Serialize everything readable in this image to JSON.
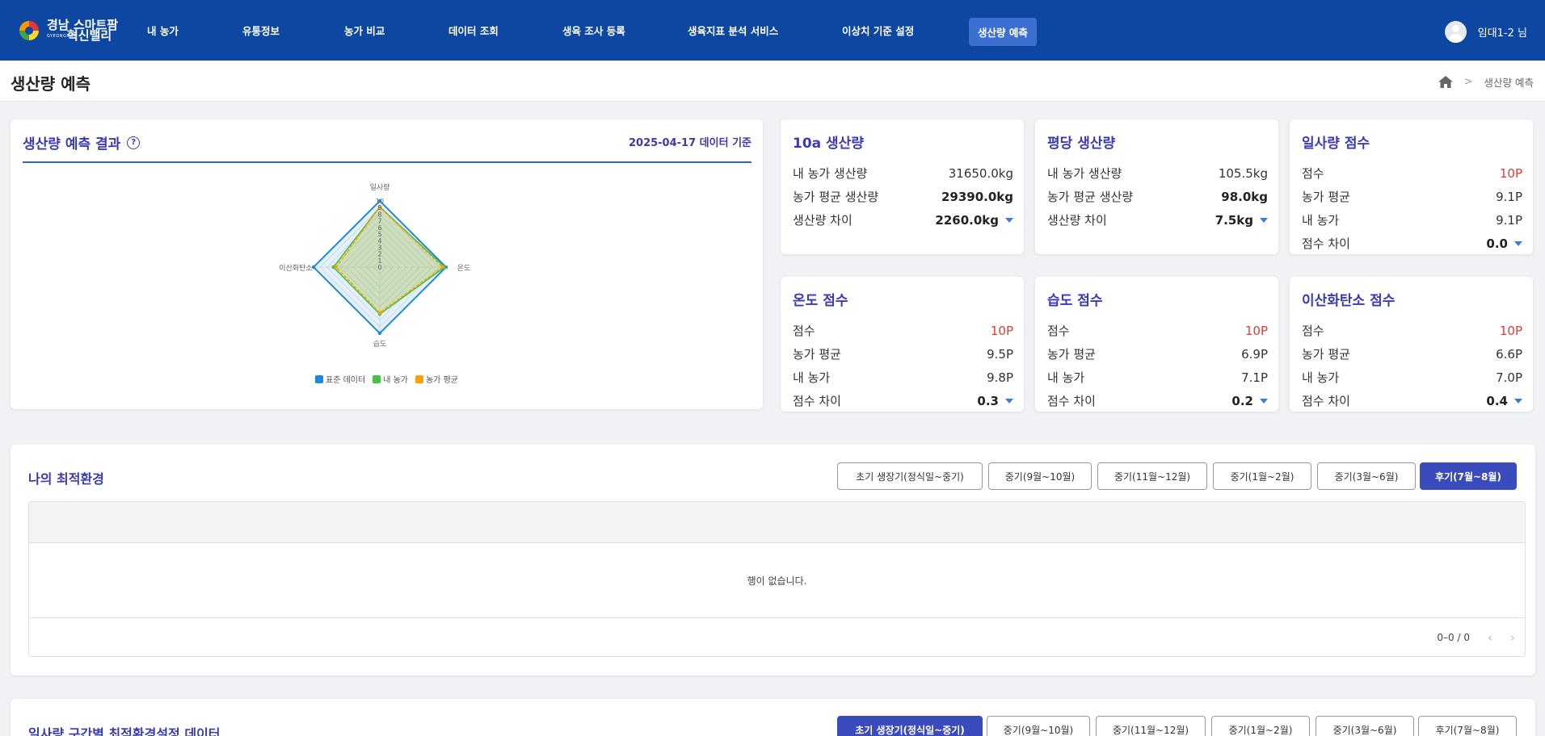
{
  "header": {
    "logo_main": "경남",
    "logo_line1": "스마트팜",
    "logo_line2": "혁신밸리",
    "logo_sub": "GYEONGNAM",
    "nav": [
      {
        "label": "내 농가"
      },
      {
        "label": "유통정보"
      },
      {
        "label": "농가 비교"
      },
      {
        "label": "데이터 조회"
      },
      {
        "label": "생육 조사 등록"
      },
      {
        "label": "생육지표 분석 서비스"
      },
      {
        "label": "이상치 기준 설정"
      },
      {
        "label": "생산량 예측",
        "active": true
      }
    ],
    "user_name": "임대1-2 님",
    "brand_color": "#0d47a1"
  },
  "page": {
    "title": "생산량 예측",
    "breadcrumb_current": "생산량 예측"
  },
  "result": {
    "title": "생산량 예측 결과",
    "help_icon": "?",
    "date": "2025-04-17 데이터 기준",
    "radar": {
      "axes": [
        "일사량",
        "온도",
        "습도",
        "이산화탄소"
      ],
      "ticks": [
        "10",
        "9",
        "8",
        "7",
        "6",
        "5",
        "4",
        "3",
        "2",
        "1",
        "0"
      ]
    },
    "legend": [
      {
        "label": "표준 데이터",
        "color": "#1e88e5"
      },
      {
        "label": "내 농가",
        "color": "#43c443"
      },
      {
        "label": "농가 평균",
        "color": "#ffa000"
      }
    ]
  },
  "chart_data": {
    "type": "radar",
    "axes": [
      "일사량",
      "온도",
      "습도",
      "이산화탄소"
    ],
    "range": [
      0,
      10
    ],
    "series": [
      {
        "name": "표준 데이터",
        "values": [
          10,
          10,
          10,
          10
        ]
      },
      {
        "name": "내 농가",
        "values": [
          9.1,
          9.8,
          7.1,
          7.0
        ]
      },
      {
        "name": "농가 평균",
        "values": [
          9.1,
          9.5,
          6.9,
          6.6
        ]
      }
    ]
  },
  "cards": [
    {
      "title": "10a 생산량",
      "rows": [
        {
          "label": "내 농가 생산량",
          "value": "31650.0kg",
          "style": "plain"
        },
        {
          "label": "농가 평균 생산량",
          "value": "29390.0kg",
          "style": "bold"
        },
        {
          "label": "생산량 차이",
          "value": "2260.0kg",
          "style": "bold",
          "caret": true
        }
      ]
    },
    {
      "title": "평당 생산량",
      "rows": [
        {
          "label": "내 농가 생산량",
          "value": "105.5kg",
          "style": "plain"
        },
        {
          "label": "농가 평균 생산량",
          "value": "98.0kg",
          "style": "bold"
        },
        {
          "label": "생산량 차이",
          "value": "7.5kg",
          "style": "bold",
          "caret": true
        }
      ]
    },
    {
      "title": "일사량 점수",
      "rows": [
        {
          "label": "점수",
          "value": "10P",
          "style": "red"
        },
        {
          "label": "농가 평균",
          "value": "9.1P",
          "style": "plain"
        },
        {
          "label": "내 농가",
          "value": "9.1P",
          "style": "plain"
        },
        {
          "label": "점수 차이",
          "value": "0.0",
          "style": "bold",
          "caret": true
        }
      ]
    },
    {
      "title": "온도 점수",
      "rows": [
        {
          "label": "점수",
          "value": "10P",
          "style": "red"
        },
        {
          "label": "농가 평균",
          "value": "9.5P",
          "style": "plain"
        },
        {
          "label": "내 농가",
          "value": "9.8P",
          "style": "plain"
        },
        {
          "label": "점수 차이",
          "value": "0.3",
          "style": "bold",
          "caret": true
        }
      ]
    },
    {
      "title": "습도 점수",
      "rows": [
        {
          "label": "점수",
          "value": "10P",
          "style": "red"
        },
        {
          "label": "농가 평균",
          "value": "6.9P",
          "style": "plain"
        },
        {
          "label": "내 농가",
          "value": "7.1P",
          "style": "plain"
        },
        {
          "label": "점수 차이",
          "value": "0.2",
          "style": "bold",
          "caret": true
        }
      ]
    },
    {
      "title": "이산화탄소 점수",
      "rows": [
        {
          "label": "점수",
          "value": "10P",
          "style": "red"
        },
        {
          "label": "농가 평균",
          "value": "6.6P",
          "style": "plain"
        },
        {
          "label": "내 농가",
          "value": "7.0P",
          "style": "plain"
        },
        {
          "label": "점수 차이",
          "value": "0.4",
          "style": "bold",
          "caret": true
        }
      ]
    }
  ],
  "optimal": {
    "title": "나의 최적환경",
    "periods": [
      {
        "label": "초기 생장기(정식일~중기)"
      },
      {
        "label": "중기(9월~10월)"
      },
      {
        "label": "중기(11월~12월)"
      },
      {
        "label": "중기(1월~2월)"
      },
      {
        "label": "중기(3월~6월)"
      },
      {
        "label": "후기(7월~8월)",
        "active": true
      }
    ],
    "empty_text": "행이 없습니다.",
    "pagination": "0–0 / 0",
    "prev_icon": "‹",
    "next_icon": "›"
  },
  "irradiance": {
    "title": "일사량 구간별 최적환경설정 데이터",
    "periods": [
      {
        "label": "초기 생장기(정식일~중기)",
        "active": true
      },
      {
        "label": "중기(9월~10월)"
      },
      {
        "label": "중기(11월~12월)"
      },
      {
        "label": "중기(1월~2월)"
      },
      {
        "label": "중기(3월~6월)"
      },
      {
        "label": "후기(7월~8월)"
      }
    ]
  }
}
